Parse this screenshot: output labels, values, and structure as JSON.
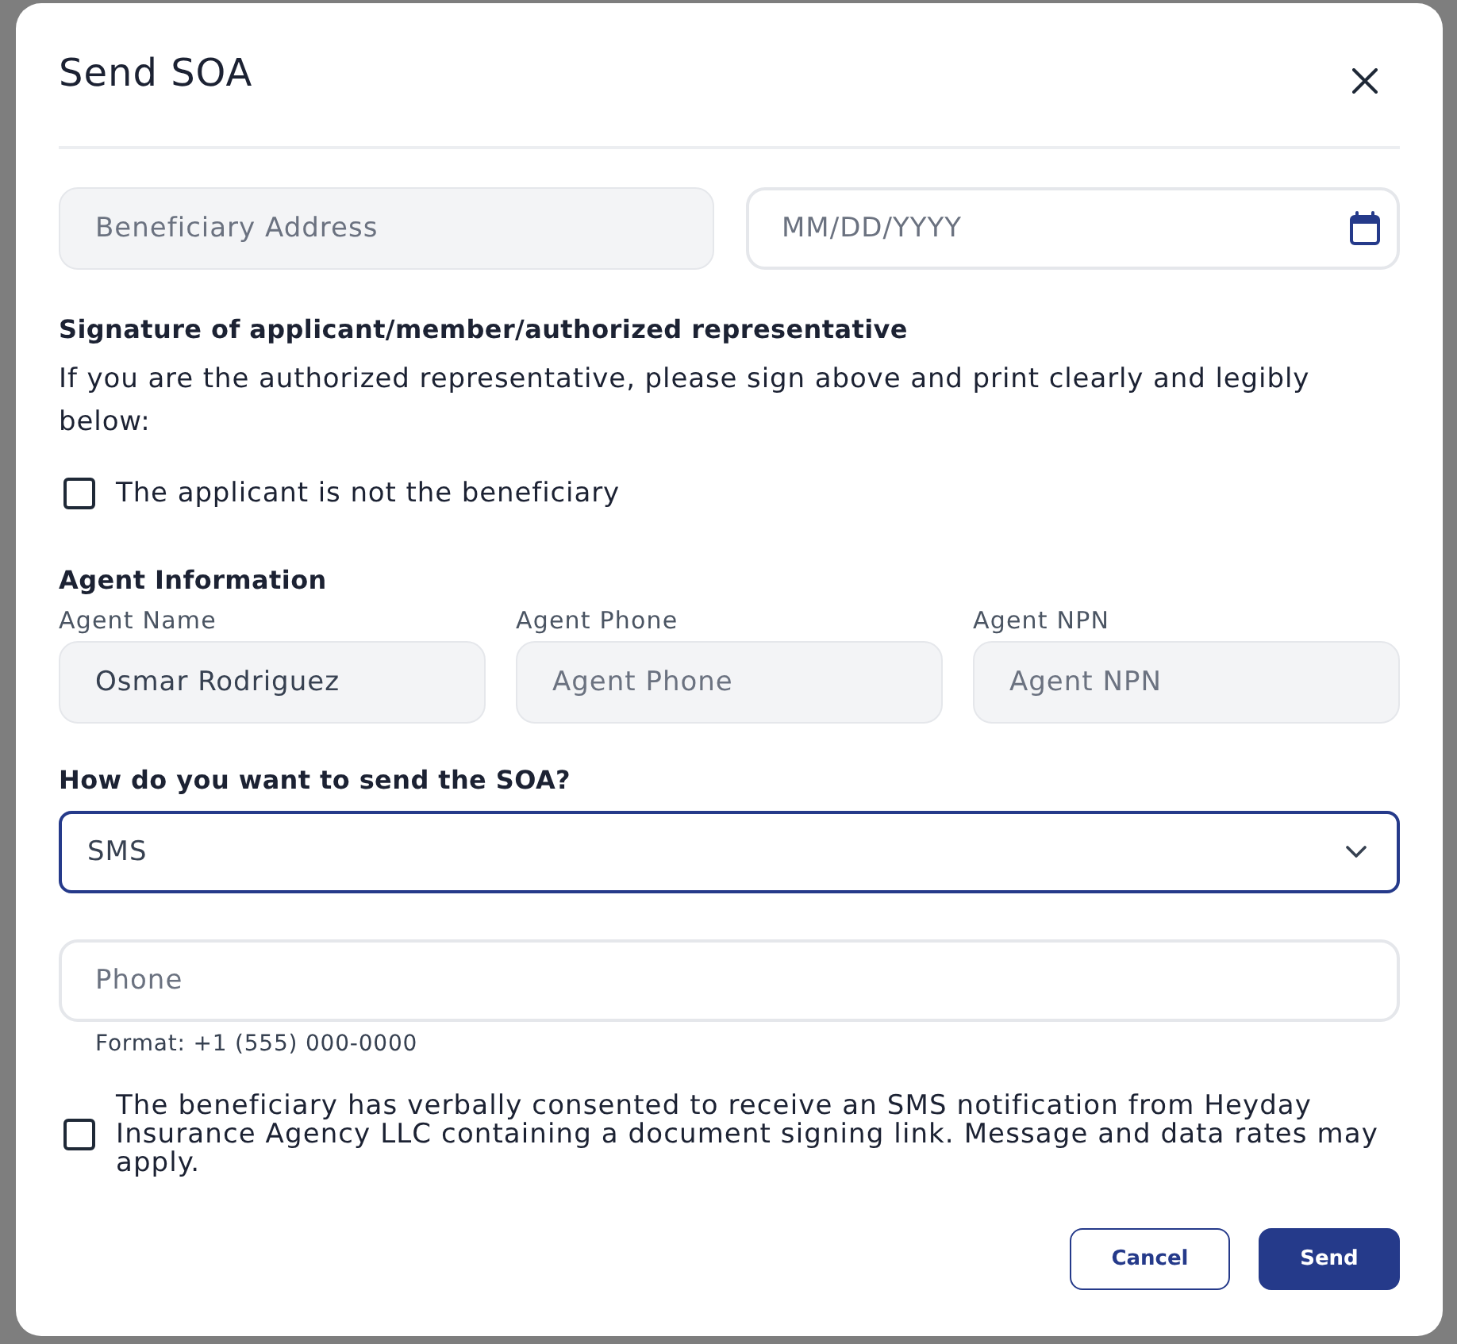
{
  "dialog": {
    "title": "Send SOA"
  },
  "address_row": [
    {
      "kind": "text",
      "placeholder": "Beneficiary Address",
      "disabled": true
    },
    {
      "kind": "date",
      "placeholder": "MM/DD/YYYY",
      "disabled": false
    }
  ],
  "signature": {
    "heading": "Signature of applicant/member/authorized representative",
    "instructions": "If you are the authorized representative, please sign above and print clearly and legibly below:",
    "checkbox": {
      "label": "The applicant is not the beneficiary",
      "checked": false
    }
  },
  "agent": {
    "heading": "Agent Information",
    "fields": [
      {
        "label": "Agent Name",
        "value": "Osmar Rodriguez",
        "disabled": true
      },
      {
        "label": "Agent Phone",
        "placeholder": "Agent Phone",
        "disabled": true
      },
      {
        "label": "Agent NPN",
        "placeholder": "Agent NPN",
        "disabled": true
      }
    ]
  },
  "delivery": {
    "question": "How do you want to send the SOA?",
    "select": {
      "value": "SMS",
      "focused": true
    },
    "phone": {
      "placeholder": "Phone",
      "disabled": false,
      "hint": "Format: +1 (555) 000-0000"
    },
    "consent": {
      "label": "The beneficiary has verbally consented to receive an SMS notification from Heyday Insurance Agency LLC containing a document signing link. Message and data rates may apply.",
      "checked": false
    }
  },
  "buttons": [
    {
      "kind": "secondary",
      "label": "Cancel"
    },
    {
      "kind": "primary",
      "label": "Send"
    }
  ]
}
